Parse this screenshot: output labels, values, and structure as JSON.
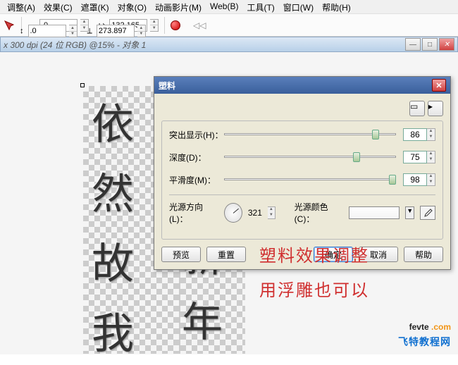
{
  "menu": [
    "调整(A)",
    "效果(C)",
    "遮罩(K)",
    "对象(O)",
    "动画影片(M)",
    "Web(B)",
    "工具(T)",
    "窗口(W)",
    "帮助(H)"
  ],
  "toolbar": {
    "x": ".0",
    "y": ".0",
    "w": "132.165",
    "h": "273.897"
  },
  "doc_title": "x 300 dpi (24 位 RGB) @15% - 对象 1",
  "dialog": {
    "title": "塑料",
    "sliders": [
      {
        "label": "突出显示(H)：",
        "value": "86",
        "pos": 86
      },
      {
        "label": "深度(D)：",
        "value": "75",
        "pos": 75
      },
      {
        "label": "平滑度(M)：",
        "value": "98",
        "pos": 98
      }
    ],
    "direction_label": "光源方向(L)：",
    "direction_value": "321",
    "color_label": "光源颜色(C)：",
    "preview": "预览",
    "reset": "重置",
    "ok": "确定",
    "cancel": "取消",
    "help": "帮助"
  },
  "annotation1": "塑料效果调整",
  "annotation2": "用浮雕也可以",
  "watermark_main": "fevte",
  "watermark_dot": ".com",
  "watermark_sub": "飞特教程网",
  "chars_left": [
    "依",
    "然",
    "故",
    "我"
  ],
  "chars_right": [
    "新",
    "年"
  ]
}
